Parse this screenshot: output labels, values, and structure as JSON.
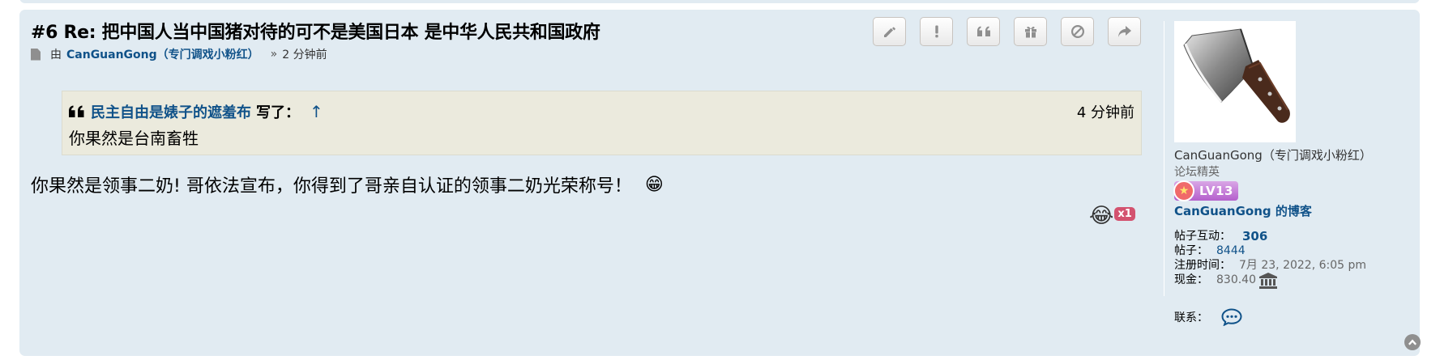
{
  "post": {
    "number_prefix": "#6",
    "title": "#6 Re: 把中国人当中国猪对待的可不是美国日本 是中华人民共和国政府",
    "by_label": "由",
    "author": "CanGuanGong（专门调戏小粉红）",
    "time_sep": "»",
    "posted_ago": "2 分钟前",
    "buttons": [
      {
        "name": "edit",
        "icon": "pencil-icon"
      },
      {
        "name": "report",
        "icon": "exclamation-icon"
      },
      {
        "name": "quote",
        "icon": "quote-icon"
      },
      {
        "name": "gift",
        "icon": "gift-icon"
      },
      {
        "name": "ignore",
        "icon": "ban-icon"
      },
      {
        "name": "share",
        "icon": "share-icon"
      }
    ],
    "quote": {
      "author": "民主自由是婊子的遮羞布",
      "wrote": "写了：",
      "up_arrow": "↑",
      "time": "4 分钟前",
      "text": "你果然是台南畜牲"
    },
    "content": "你果然是领事二奶! 哥依法宣布，你得到了哥亲自认证的领事二奶光荣称号！",
    "content_emoji": "😁",
    "reaction": {
      "emoji": "😂",
      "count": "x1"
    }
  },
  "profile": {
    "avatar": "cleaver-knife-avatar",
    "name": "CanGuanGong（专门调戏小粉红）",
    "rank_title": "论坛精英",
    "rank_badge": "LV13",
    "blog_link": "CanGuanGong 的博客",
    "stats": {
      "interactions_label": "帖子互动：",
      "interactions": "306",
      "posts_label": "帖子：",
      "posts": "8444",
      "joined_label": "注册时间：",
      "joined": "7月 23, 2022, 6:05 pm",
      "cash_label": "现金：",
      "cash": "830.40"
    },
    "contact_label": "联系："
  },
  "colors": {
    "post_bg": "#e1ebf2",
    "link": "#105289",
    "quote_bg": "#ebeadd",
    "reaction_badge": "#d3526f"
  }
}
